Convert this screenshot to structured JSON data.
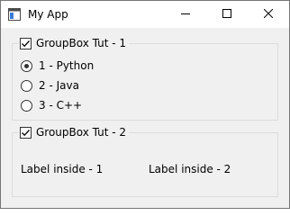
{
  "window": {
    "title": "My App",
    "icon": "app-window-icon",
    "controls": {
      "minimize": "minimize-icon",
      "maximize": "maximize-icon",
      "close": "close-icon"
    }
  },
  "groupbox1": {
    "title": "GroupBox Tut - 1",
    "checked": true,
    "radios": [
      {
        "label": "1 - Python",
        "selected": true
      },
      {
        "label": "2 - Java",
        "selected": false
      },
      {
        "label": "3 - C++",
        "selected": false
      }
    ]
  },
  "groupbox2": {
    "title": "GroupBox Tut - 2",
    "checked": true,
    "labels": [
      "Label inside - 1",
      "Label inside - 2"
    ]
  },
  "colors": {
    "window_bg": "#f0f0f0",
    "titlebar_bg": "#ffffff",
    "groupbox_border": "#dcdcdc",
    "control_border": "#333333"
  }
}
